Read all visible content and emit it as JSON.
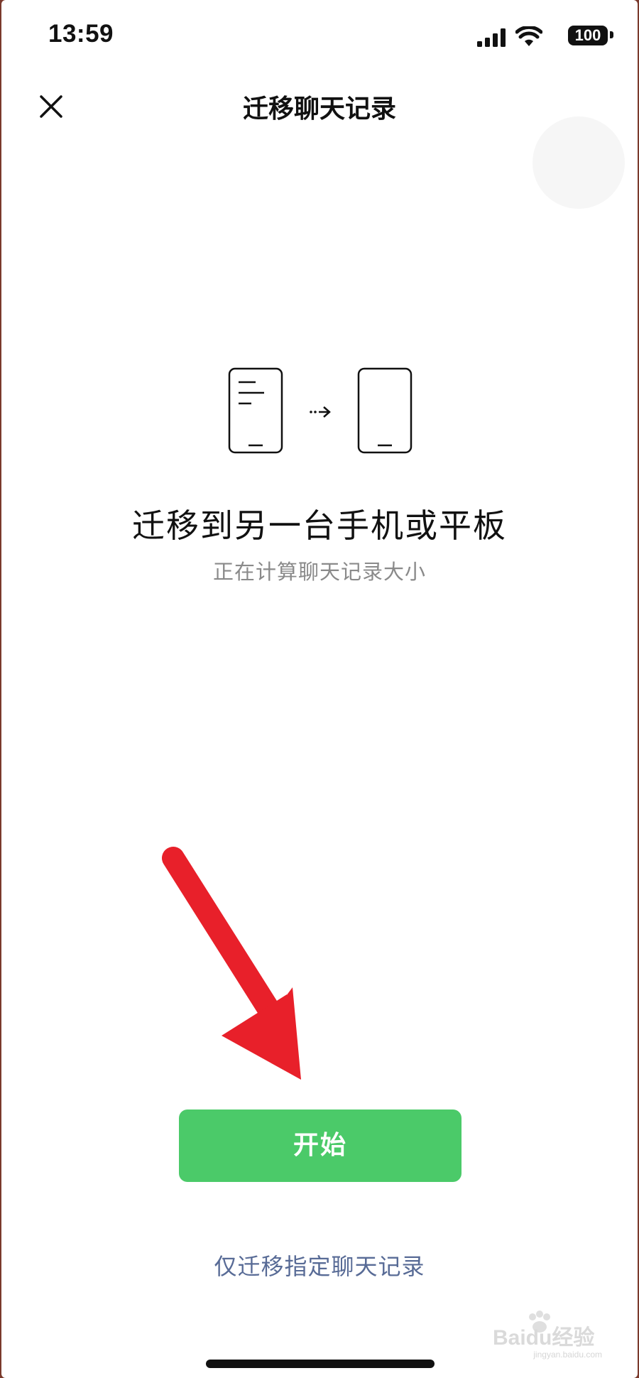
{
  "status_bar": {
    "time": "13:59",
    "battery": "100",
    "icons": [
      "signal-icon",
      "wifi-icon",
      "battery-icon"
    ]
  },
  "nav": {
    "title": "迁移聊天记录",
    "close_icon": "close-icon"
  },
  "illustration": {
    "icons": [
      "source-phone-icon",
      "dotted-arrow-icon",
      "target-phone-icon"
    ]
  },
  "main": {
    "headline": "迁移到另一台手机或平板",
    "status_text": "正在计算聊天记录大小"
  },
  "actions": {
    "start_label": "开始",
    "partial_link": "仅迁移指定聊天记录"
  },
  "overlay": {
    "annotation": "red-arrow-icon"
  },
  "watermark": {
    "text": "Baidu经验",
    "sub": "jingyan.baidu.com"
  },
  "colors": {
    "accent_green": "#4bca69",
    "link_blue": "#586b96",
    "annotation_red": "#e8202a"
  }
}
